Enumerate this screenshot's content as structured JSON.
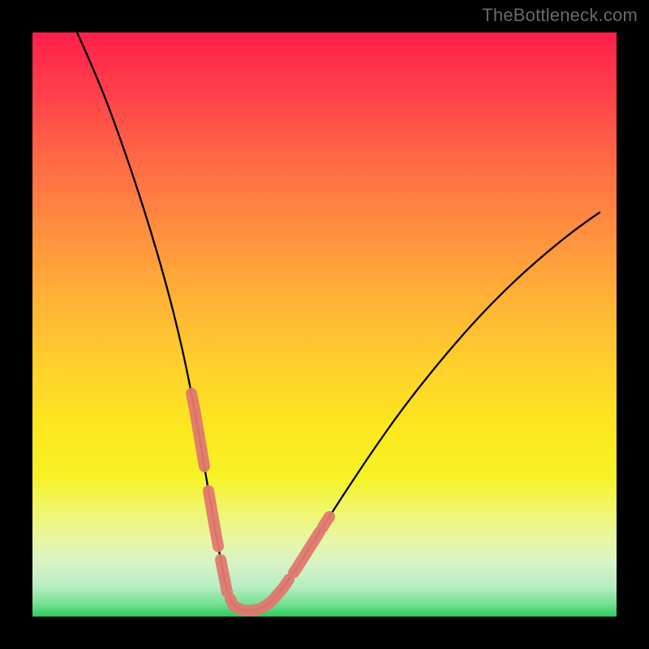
{
  "watermark": "TheBottleneck.com",
  "colors": {
    "page_bg": "#000000",
    "gradient_top": "#ff1f4b",
    "gradient_mid": "#ffd22a",
    "gradient_bottom": "#29cc5e",
    "curve": "#000000",
    "overlay_band": "#e0786f"
  },
  "chart_data": {
    "type": "line",
    "title": "",
    "xlabel": "",
    "ylabel": "",
    "x": [
      0.0,
      0.05,
      0.1,
      0.13,
      0.16,
      0.19,
      0.22,
      0.25,
      0.28,
      0.3,
      0.32,
      0.34,
      0.36,
      0.38,
      0.4,
      0.45,
      0.5,
      0.55,
      0.6,
      0.65,
      0.7,
      0.75,
      0.8,
      0.85,
      0.9,
      0.95,
      1.0
    ],
    "values": [
      1.0,
      0.82,
      0.65,
      0.55,
      0.45,
      0.35,
      0.25,
      0.15,
      0.08,
      0.04,
      0.02,
      0.0,
      0.0,
      0.01,
      0.03,
      0.08,
      0.14,
      0.21,
      0.28,
      0.36,
      0.44,
      0.52,
      0.6,
      0.66,
      0.71,
      0.74,
      0.77
    ],
    "xlim": [
      0,
      1
    ],
    "ylim": [
      0,
      1
    ],
    "grid": false,
    "annotations": {
      "min_x": 0.34,
      "overlay_segments": [
        {
          "x0": 0.235,
          "x1": 0.255
        },
        {
          "x0": 0.265,
          "x1": 0.285
        },
        {
          "x0": 0.29,
          "x1": 0.4
        },
        {
          "x0": 0.41,
          "x1": 0.47
        },
        {
          "x0": 0.48,
          "x1": 0.5
        }
      ]
    }
  }
}
